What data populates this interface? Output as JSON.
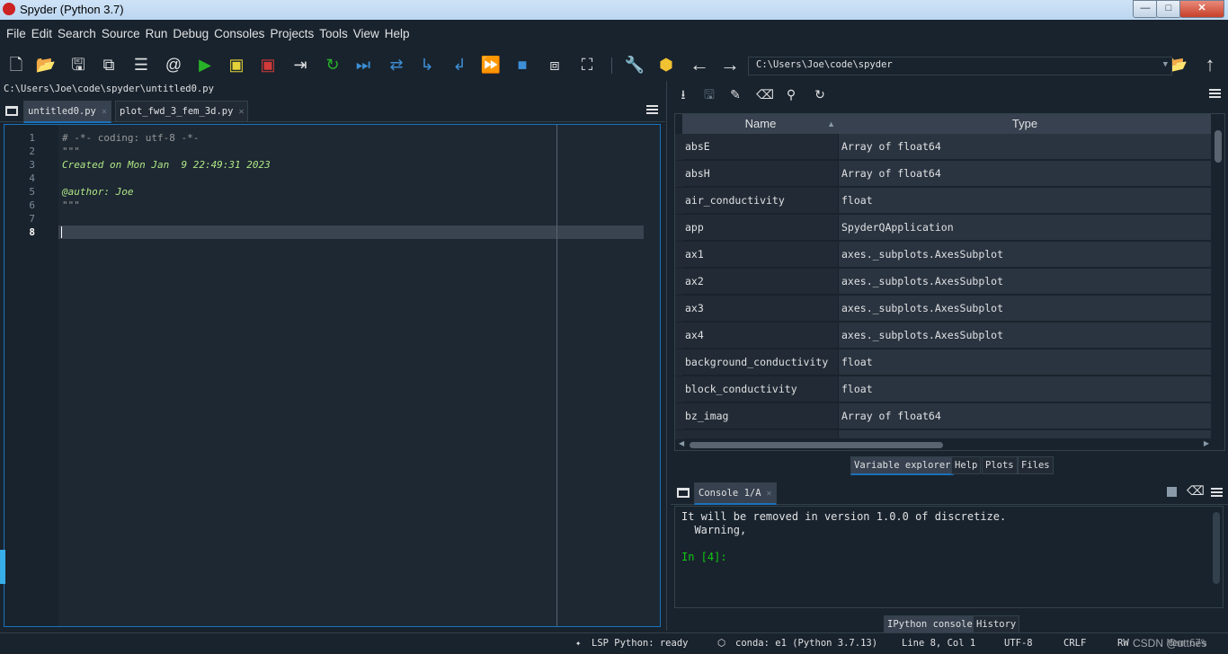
{
  "window": {
    "title": "Spyder (Python 3.7)",
    "controls": {
      "minimize": "—",
      "maximize": "□",
      "close": "✕"
    }
  },
  "menu": [
    "File",
    "Edit",
    "Search",
    "Source",
    "Run",
    "Debug",
    "Consoles",
    "Projects",
    "Tools",
    "View",
    "Help"
  ],
  "toolbar": {
    "icons": [
      "new-file-icon",
      "open-file-icon",
      "save-icon",
      "save-all-icon",
      "outline-icon",
      "at-icon",
      "run-icon",
      "run-cell-icon",
      "run-cell-advance-icon",
      "run-selection-icon",
      "rerun-icon",
      "debug-icon",
      "step-icon",
      "step-into-icon",
      "step-return-icon",
      "continue-icon",
      "stop-debug-icon",
      "maximize-pane-icon",
      "fullscreen-icon",
      "preferences-icon",
      "python-path-icon",
      "back-icon",
      "forward-icon",
      "browse-folder-icon",
      "parent-dir-icon"
    ],
    "working_dir": "C:\\Users\\Joe\\code\\spyder"
  },
  "editor": {
    "path": "C:\\Users\\Joe\\code\\spyder\\untitled0.py",
    "tabs": [
      {
        "label": "untitled0.py",
        "close": "✕"
      },
      {
        "label": "plot_fwd_3_fem_3d.py",
        "close": "✕"
      }
    ],
    "lines": [
      {
        "num": "1",
        "text": "# -*- coding: utf-8 -*-"
      },
      {
        "num": "2",
        "text": "\"\"\""
      },
      {
        "num": "3",
        "text": "Created on Mon Jan  9 22:49:31 2023"
      },
      {
        "num": "4",
        "text": ""
      },
      {
        "num": "5",
        "text": "@author: Joe"
      },
      {
        "num": "6",
        "text": "\"\"\""
      },
      {
        "num": "7",
        "text": ""
      },
      {
        "num": "8",
        "text": ""
      }
    ]
  },
  "variable_explorer": {
    "columns": [
      "Name",
      "Type"
    ],
    "rows": [
      {
        "name": "absE",
        "type": "Array of float64"
      },
      {
        "name": "absH",
        "type": "Array of float64"
      },
      {
        "name": "air_conductivity",
        "type": "float"
      },
      {
        "name": "app",
        "type": "SpyderQApplication"
      },
      {
        "name": "ax1",
        "type": "axes._subplots.AxesSubplot"
      },
      {
        "name": "ax2",
        "type": "axes._subplots.AxesSubplot"
      },
      {
        "name": "ax3",
        "type": "axes._subplots.AxesSubplot"
      },
      {
        "name": "ax4",
        "type": "axes._subplots.AxesSubplot"
      },
      {
        "name": "background_conductivity",
        "type": "float"
      },
      {
        "name": "block_conductivity",
        "type": "float"
      },
      {
        "name": "bz_imag",
        "type": "Array of float64"
      }
    ],
    "pane_tabs": [
      "Variable explorer",
      "Help",
      "Plots",
      "Files"
    ]
  },
  "console": {
    "tab": "Console 1/A",
    "tab_close": "✕",
    "lines": [
      "It will be removed in version 1.0.0 of discretize.",
      "  Warning,"
    ],
    "prompt": "In [4]:",
    "pane_tabs": [
      "IPython console",
      "History"
    ]
  },
  "statusbar": {
    "lsp": "LSP Python: ready",
    "conda": "conda: e1 (Python 3.7.13)",
    "position": "Line 8, Col 1",
    "encoding": "UTF-8",
    "eol": "CRLF",
    "rw": "RW",
    "memory": "Mem 67%",
    "watermark": "CSDN @uttnes"
  }
}
